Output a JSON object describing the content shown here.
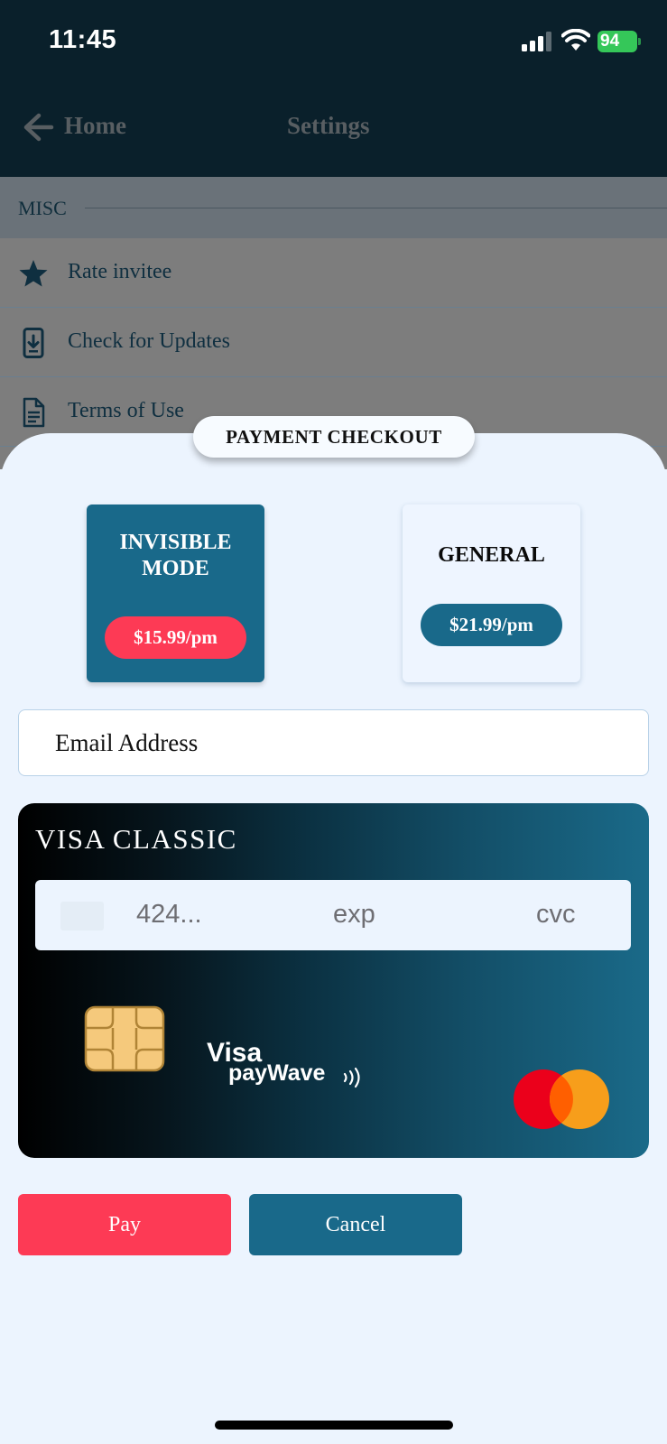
{
  "status_bar": {
    "time": "11:45",
    "battery": "94"
  },
  "nav": {
    "back_label": "Home",
    "title": "Settings"
  },
  "section": {
    "label": "MISC"
  },
  "rows": [
    {
      "label": "Rate invitee",
      "icon": "star-icon"
    },
    {
      "label": "Check for Updates",
      "icon": "phone-download-icon"
    },
    {
      "label": "Terms of Use",
      "icon": "document-icon"
    }
  ],
  "payment": {
    "title": "PAYMENT CHECKOUT",
    "plans": [
      {
        "name": "Invisible Mode",
        "price": "$15.99/pm",
        "selected": true
      },
      {
        "name": "GENERAL",
        "price": "$21.99/pm",
        "selected": false
      }
    ],
    "email_placeholder": "Email Address",
    "card": {
      "title": "VISA CLASSIC",
      "number_placeholder": "424...",
      "exp_placeholder": "exp",
      "cvc_placeholder": "cvc",
      "paywave_visa": "Visa",
      "paywave_text": "payWave"
    },
    "pay_label": "Pay",
    "cancel_label": "Cancel"
  },
  "colors": {
    "accent_red": "#fd3a55",
    "accent_teal": "#19698a",
    "sheet_bg": "#ecf4fe",
    "battery_green": "#35c759"
  }
}
